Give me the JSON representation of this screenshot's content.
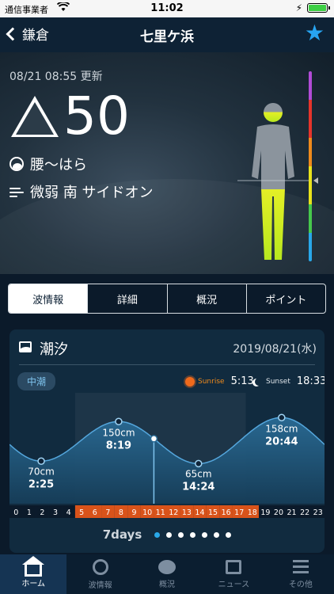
{
  "status_bar": {
    "carrier": "通信事業者",
    "time": "11:02"
  },
  "nav": {
    "back_label": "鎌倉",
    "title": "七里ケ浜",
    "favorite_icon": "star-icon"
  },
  "hero": {
    "updated": "08/21 08:55 更新",
    "score": "50",
    "wave_size": "腰〜はら",
    "wind": "微弱 南 サイドオン"
  },
  "segments": [
    {
      "label": "波情報",
      "active": true
    },
    {
      "label": "詳細",
      "active": false
    },
    {
      "label": "概況",
      "active": false
    },
    {
      "label": "ポイント",
      "active": false
    }
  ],
  "tide": {
    "title": "潮汐",
    "date": "2019/08/21(水)",
    "tide_type": "中潮",
    "sunrise_label": "Sunrise",
    "sunrise_time": "5:13",
    "sunset_label": "Sunset",
    "sunset_time": "18:33",
    "extremes": [
      {
        "height": "70cm",
        "time": "2:25"
      },
      {
        "height": "150cm",
        "time": "8:19"
      },
      {
        "height": "65cm",
        "time": "14:24"
      },
      {
        "height": "158cm",
        "time": "20:44"
      }
    ],
    "hours": [
      "0",
      "1",
      "2",
      "3",
      "4",
      "5",
      "6",
      "7",
      "8",
      "9",
      "10",
      "11",
      "12",
      "13",
      "14",
      "15",
      "16",
      "17",
      "18",
      "19",
      "20",
      "21",
      "22",
      "23"
    ],
    "daylight_hours": [
      5,
      18
    ],
    "current_hour": 11,
    "days_label": "7days",
    "days_count": 7,
    "active_day": 0
  },
  "tabbar": [
    {
      "label": "ホーム",
      "icon": "home-icon",
      "active": true
    },
    {
      "label": "波情報",
      "icon": "wave-icon",
      "active": false
    },
    {
      "label": "概況",
      "icon": "chat-icon",
      "active": false
    },
    {
      "label": "ニュース",
      "icon": "news-icon",
      "active": false
    },
    {
      "label": "その他",
      "icon": "more-icon",
      "active": false
    }
  ],
  "colors": {
    "accent": "#27a5f2",
    "daylight": "#d9531a",
    "figure_glow": "#c7f024"
  }
}
